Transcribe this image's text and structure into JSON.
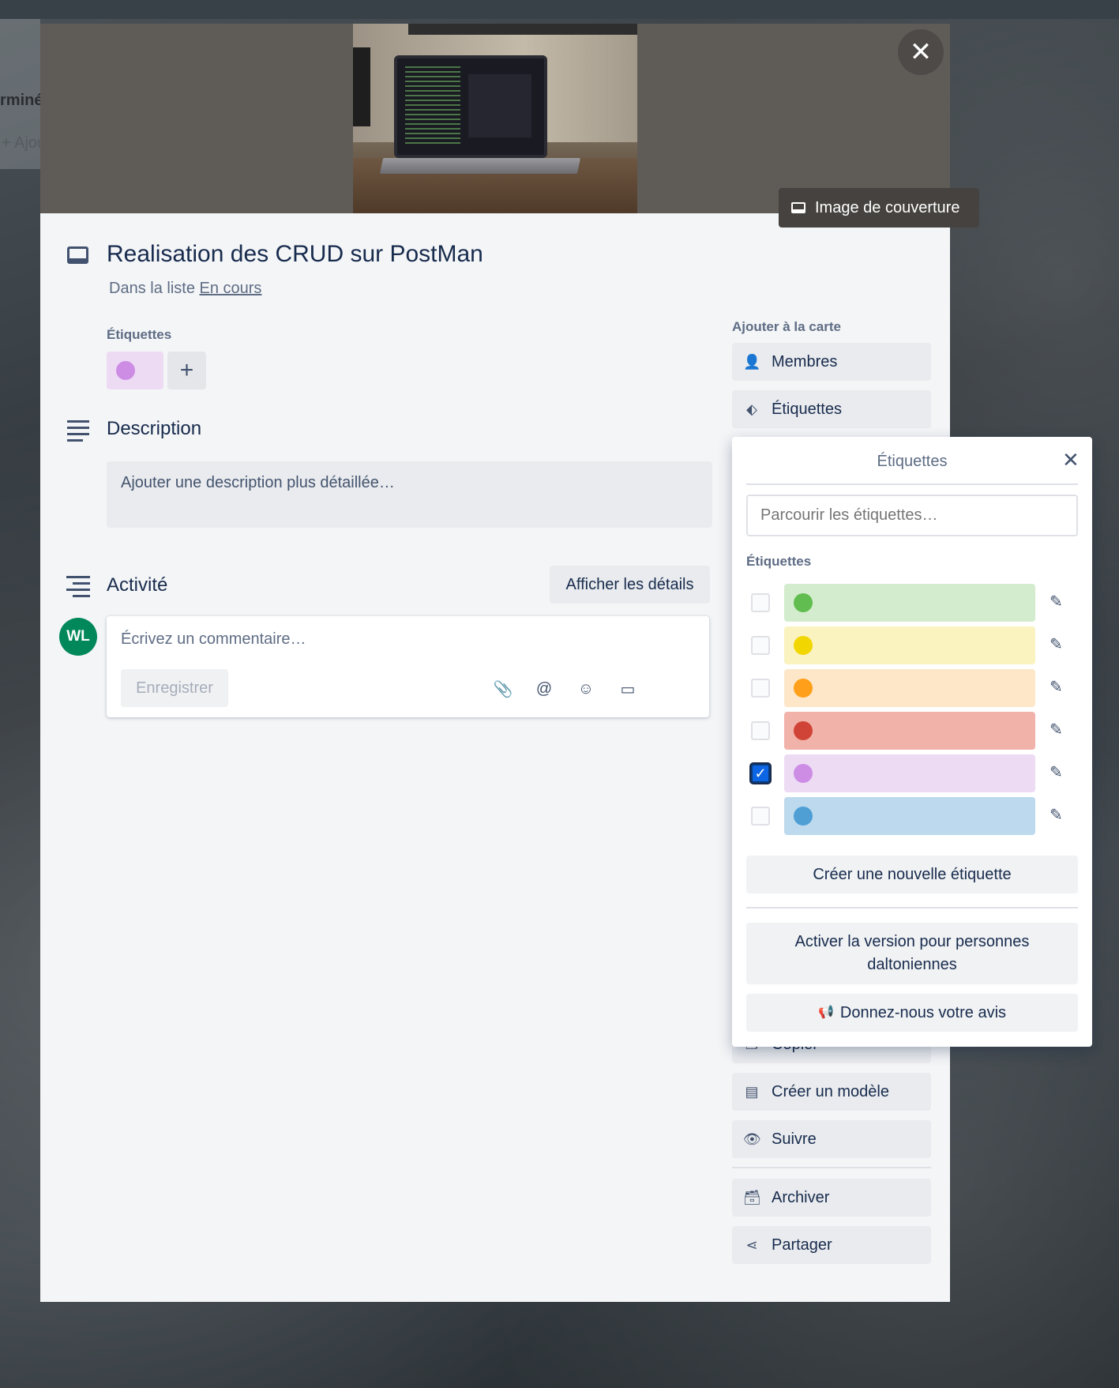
{
  "background": {
    "list_title_fragment": "rminé",
    "add_fragment": "+ Ajou"
  },
  "cover": {
    "button_label": "Image de couverture",
    "close_icon": "close-icon"
  },
  "card": {
    "title": "Realisation des CRUD sur PostMan",
    "in_list_prefix": "Dans la liste",
    "list_name": "En cours",
    "labels_heading": "Étiquettes",
    "applied_label_color": "#cd8de5",
    "description_heading": "Description",
    "description_placeholder": "Ajouter une description plus détaillée…",
    "activity_heading": "Activité",
    "show_details_label": "Afficher les détails",
    "avatar_initials": "WL",
    "comment_placeholder": "Écrivez un commentaire…",
    "save_label": "Enregistrer"
  },
  "sidebar": {
    "heading": "Ajouter à la carte",
    "buttons": {
      "members": "Membres",
      "labels": "Étiquettes",
      "copy": "Copier",
      "template": "Créer un modèle",
      "follow": "Suivre",
      "archive": "Archiver",
      "share": "Partager"
    }
  },
  "labels_popover": {
    "title": "Étiquettes",
    "search_placeholder": "Parcourir les étiquettes…",
    "section_heading": "Étiquettes",
    "labels": [
      {
        "color": "#61bd4f",
        "bg": "#d3ecce",
        "checked": false
      },
      {
        "color": "#f2d600",
        "bg": "#faf3c0",
        "checked": false
      },
      {
        "color": "#ff9f1a",
        "bg": "#fde7c8",
        "checked": false
      },
      {
        "color": "#d04437",
        "bg": "#f1b2aa",
        "checked": false
      },
      {
        "color": "#cd8de5",
        "bg": "#eddbf4",
        "checked": true
      },
      {
        "color": "#4f9fd5",
        "bg": "#bcd9ee",
        "checked": false
      }
    ],
    "create_label": "Créer une nouvelle étiquette",
    "colorblind_label": "Activer la version pour personnes daltoniennes",
    "feedback_label": "Donnez-nous votre avis"
  }
}
